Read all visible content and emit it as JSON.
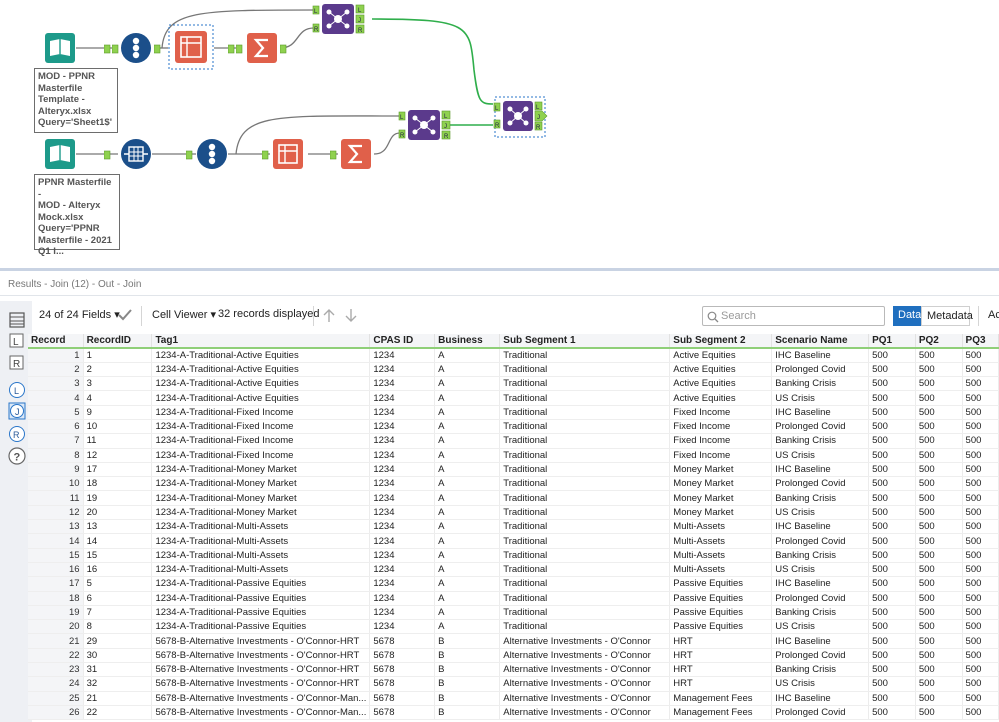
{
  "workflow": {
    "annotations": [
      "MOD - PPNR\nMasterfile\nTemplate -\nAlteryx.xlsx\nQuery='Sheet1$'",
      "PPNR Masterfile -\nMOD - Alteryx\nMock.xlsx\nQuery='PPNR\nMasterfile - 2021\nQ1 I..."
    ],
    "join_anchors": {
      "left": "L",
      "join": "J",
      "right": "R"
    }
  },
  "results": {
    "title": "Results - Join (12) - Out - Join",
    "fields_label": "24 of 24 Fields",
    "cell_viewer_label": "Cell Viewer",
    "records_label": "32 records displayed",
    "search_placeholder": "Search",
    "tab_data": "Data",
    "tab_metadata": "Metadata",
    "tab_more": "Ac"
  },
  "table": {
    "columns": [
      "Record",
      "RecordID",
      "Tag1",
      "CPAS ID",
      "Business",
      "Sub Segment 1",
      "Sub Segment 2",
      "Scenario Name",
      "PQ1",
      "PQ2",
      "PQ3"
    ],
    "rows": [
      [
        "1",
        "1",
        "1234-A-Traditional-Active Equities",
        "1234",
        "A",
        "Traditional",
        "Active Equities",
        "IHC Baseline",
        "500",
        "500",
        "500"
      ],
      [
        "2",
        "2",
        "1234-A-Traditional-Active Equities",
        "1234",
        "A",
        "Traditional",
        "Active Equities",
        "Prolonged Covid",
        "500",
        "500",
        "500"
      ],
      [
        "3",
        "3",
        "1234-A-Traditional-Active Equities",
        "1234",
        "A",
        "Traditional",
        "Active Equities",
        "Banking Crisis",
        "500",
        "500",
        "500"
      ],
      [
        "4",
        "4",
        "1234-A-Traditional-Active Equities",
        "1234",
        "A",
        "Traditional",
        "Active Equities",
        "US Crisis",
        "500",
        "500",
        "500"
      ],
      [
        "5",
        "9",
        "1234-A-Traditional-Fixed Income",
        "1234",
        "A",
        "Traditional",
        "Fixed Income",
        "IHC Baseline",
        "500",
        "500",
        "500"
      ],
      [
        "6",
        "10",
        "1234-A-Traditional-Fixed Income",
        "1234",
        "A",
        "Traditional",
        "Fixed Income",
        "Prolonged Covid",
        "500",
        "500",
        "500"
      ],
      [
        "7",
        "11",
        "1234-A-Traditional-Fixed Income",
        "1234",
        "A",
        "Traditional",
        "Fixed Income",
        "Banking Crisis",
        "500",
        "500",
        "500"
      ],
      [
        "8",
        "12",
        "1234-A-Traditional-Fixed Income",
        "1234",
        "A",
        "Traditional",
        "Fixed Income",
        "US Crisis",
        "500",
        "500",
        "500"
      ],
      [
        "9",
        "17",
        "1234-A-Traditional-Money Market",
        "1234",
        "A",
        "Traditional",
        "Money Market",
        "IHC Baseline",
        "500",
        "500",
        "500"
      ],
      [
        "10",
        "18",
        "1234-A-Traditional-Money Market",
        "1234",
        "A",
        "Traditional",
        "Money Market",
        "Prolonged Covid",
        "500",
        "500",
        "500"
      ],
      [
        "11",
        "19",
        "1234-A-Traditional-Money Market",
        "1234",
        "A",
        "Traditional",
        "Money Market",
        "Banking Crisis",
        "500",
        "500",
        "500"
      ],
      [
        "12",
        "20",
        "1234-A-Traditional-Money Market",
        "1234",
        "A",
        "Traditional",
        "Money Market",
        "US Crisis",
        "500",
        "500",
        "500"
      ],
      [
        "13",
        "13",
        "1234-A-Traditional-Multi-Assets",
        "1234",
        "A",
        "Traditional",
        "Multi-Assets",
        "IHC Baseline",
        "500",
        "500",
        "500"
      ],
      [
        "14",
        "14",
        "1234-A-Traditional-Multi-Assets",
        "1234",
        "A",
        "Traditional",
        "Multi-Assets",
        "Prolonged Covid",
        "500",
        "500",
        "500"
      ],
      [
        "15",
        "15",
        "1234-A-Traditional-Multi-Assets",
        "1234",
        "A",
        "Traditional",
        "Multi-Assets",
        "Banking Crisis",
        "500",
        "500",
        "500"
      ],
      [
        "16",
        "16",
        "1234-A-Traditional-Multi-Assets",
        "1234",
        "A",
        "Traditional",
        "Multi-Assets",
        "US Crisis",
        "500",
        "500",
        "500"
      ],
      [
        "17",
        "5",
        "1234-A-Traditional-Passive Equities",
        "1234",
        "A",
        "Traditional",
        "Passive Equities",
        "IHC Baseline",
        "500",
        "500",
        "500"
      ],
      [
        "18",
        "6",
        "1234-A-Traditional-Passive Equities",
        "1234",
        "A",
        "Traditional",
        "Passive Equities",
        "Prolonged Covid",
        "500",
        "500",
        "500"
      ],
      [
        "19",
        "7",
        "1234-A-Traditional-Passive Equities",
        "1234",
        "A",
        "Traditional",
        "Passive Equities",
        "Banking Crisis",
        "500",
        "500",
        "500"
      ],
      [
        "20",
        "8",
        "1234-A-Traditional-Passive Equities",
        "1234",
        "A",
        "Traditional",
        "Passive Equities",
        "US Crisis",
        "500",
        "500",
        "500"
      ],
      [
        "21",
        "29",
        "5678-B-Alternative Investments - O'Connor-HRT",
        "5678",
        "B",
        "Alternative Investments - O'Connor",
        "HRT",
        "IHC Baseline",
        "500",
        "500",
        "500"
      ],
      [
        "22",
        "30",
        "5678-B-Alternative Investments - O'Connor-HRT",
        "5678",
        "B",
        "Alternative Investments - O'Connor",
        "HRT",
        "Prolonged Covid",
        "500",
        "500",
        "500"
      ],
      [
        "23",
        "31",
        "5678-B-Alternative Investments - O'Connor-HRT",
        "5678",
        "B",
        "Alternative Investments - O'Connor",
        "HRT",
        "Banking Crisis",
        "500",
        "500",
        "500"
      ],
      [
        "24",
        "32",
        "5678-B-Alternative Investments - O'Connor-HRT",
        "5678",
        "B",
        "Alternative Investments - O'Connor",
        "HRT",
        "US Crisis",
        "500",
        "500",
        "500"
      ],
      [
        "25",
        "21",
        "5678-B-Alternative Investments - O'Connor-Man...",
        "5678",
        "B",
        "Alternative Investments - O'Connor",
        "Management Fees",
        "IHC Baseline",
        "500",
        "500",
        "500"
      ],
      [
        "26",
        "22",
        "5678-B-Alternative Investments - O'Connor-Man...",
        "5678",
        "B",
        "Alternative Investments - O'Connor",
        "Management Fees",
        "Prolonged Covid",
        "500",
        "500",
        "500"
      ]
    ]
  },
  "colors": {
    "input_tool": "#1d9a8a",
    "recordid_tool": "#1b4f8a",
    "select_tool": "#e0604a",
    "summarize_tool": "#e0604a",
    "join_tool": "#5b3a8c",
    "anchor_green": "#8fd14f",
    "accent_blue": "#1f6fbf"
  }
}
